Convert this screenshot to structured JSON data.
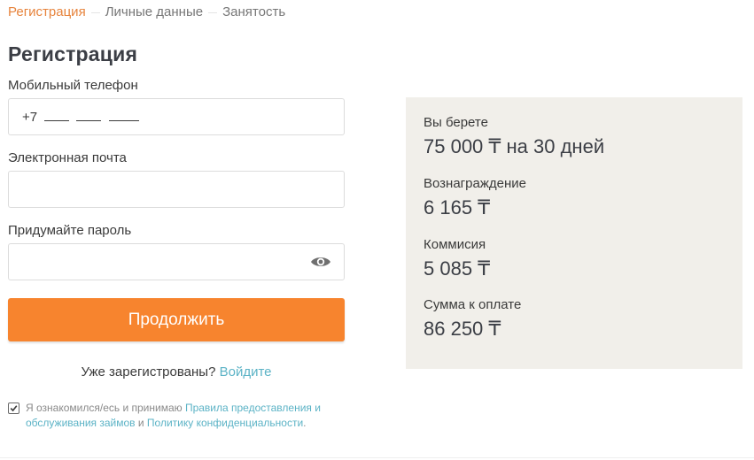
{
  "steps": [
    {
      "label": "Регистрация",
      "active": true
    },
    {
      "label": "Личные данные",
      "active": false
    },
    {
      "label": "Занятость",
      "active": false
    }
  ],
  "form": {
    "title": "Регистрация",
    "phone": {
      "label": "Мобильный телефон",
      "prefix": "+7"
    },
    "email": {
      "label": "Электронная почта",
      "value": ""
    },
    "password": {
      "label": "Придумайте пароль",
      "value": ""
    },
    "submit_label": "Продолжить",
    "login": {
      "question": "Уже зарегистрованы?",
      "link": "Войдите"
    },
    "consent": {
      "checked": true,
      "text_before": "Я ознакомился/есь и принимаю ",
      "link1": "Правила предоставления и обслуживания займов",
      "middle": " и ",
      "link2": "Политику конфиденциальности",
      "text_after": "."
    }
  },
  "summary": {
    "rows": [
      {
        "label": "Вы берете",
        "value": "75 000 ₸ на 30 дней"
      },
      {
        "label": "Вознаграждение",
        "value": "6 165 ₸"
      },
      {
        "label": "Коммисия",
        "value": "5 085 ₸"
      },
      {
        "label": "Сумма к оплате",
        "value": "86 250 ₸"
      }
    ]
  },
  "colors": {
    "accent": "#f7842e",
    "active_step": "#e7843d",
    "link": "#5cb3c6",
    "summary_bg": "#f1efea"
  },
  "icons": {
    "password_toggle": "eye-icon",
    "consent_check": "checkmark-icon"
  }
}
